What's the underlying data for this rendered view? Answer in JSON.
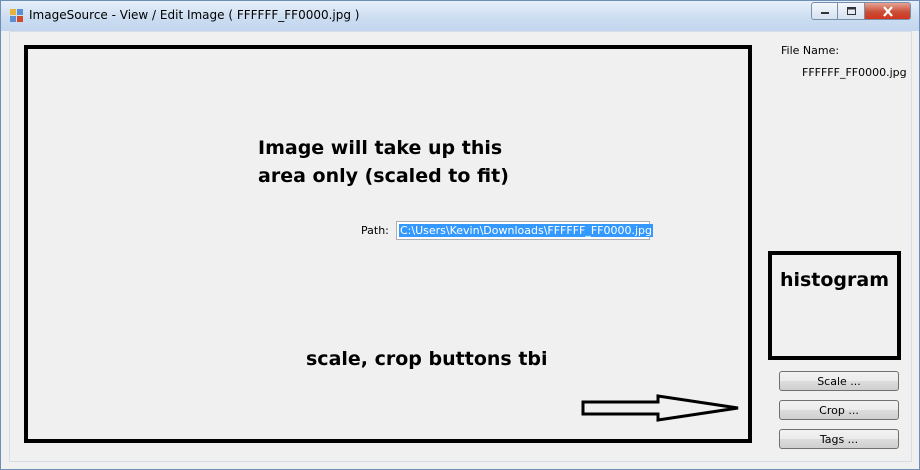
{
  "window": {
    "title": "ImageSource - View / Edit Image ( FFFFFF_FF0000.jpg )",
    "controls": {
      "minimize": "minimize-icon",
      "maximize": "maximize-icon",
      "close": "close-icon"
    }
  },
  "notes": {
    "image_area_line1": "Image will take up this",
    "image_area_line2": "area only (scaled to fit)",
    "buttons_note": "scale, crop buttons tbi",
    "histogram": "histogram"
  },
  "path": {
    "label": "Path:",
    "value": "C:\\Users\\Kevin\\Downloads\\FFFFFF_FF0000.jpg"
  },
  "file": {
    "label": "File Name:",
    "value": "FFFFFF_FF0000.jpg"
  },
  "buttons": {
    "scale": "Scale ...",
    "crop": "Crop ...",
    "tags": "Tags ..."
  },
  "colors": {
    "title_bar": "#c3d6ee",
    "close_button": "#c94f38",
    "selection": "#3399ff"
  }
}
